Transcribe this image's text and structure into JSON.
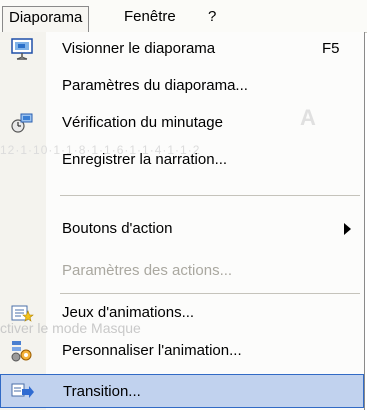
{
  "menubar": {
    "items": [
      {
        "label": "Diaporama",
        "active": true
      },
      {
        "label": "Fenêtre",
        "active": false
      },
      {
        "label": "?",
        "active": false
      }
    ]
  },
  "background_text": {
    "ruler": "12·1·10·1·1·8·1·1·6·1·1·4·1·1·2",
    "masque": "ctiver le mode Masque",
    "format_letter": "A"
  },
  "menu": {
    "items": [
      {
        "label": "Visionner le diaporama",
        "shortcut": "F5",
        "icon": "slideshow-icon"
      },
      {
        "label": "Paramètres du diaporama...",
        "shortcut": ""
      },
      {
        "label": "Vérification du minutage",
        "shortcut": "",
        "icon": "rehearse-timings-icon"
      },
      {
        "label": "Enregistrer la narration...",
        "shortcut": ""
      },
      {
        "label": "Boutons d'action",
        "submenu": true
      },
      {
        "label": "Paramètres des actions...",
        "disabled": true
      },
      {
        "label": "Jeux d'animations...",
        "icon": "animation-schemes-icon"
      },
      {
        "label": "Personnaliser l'animation...",
        "icon": "custom-animation-icon"
      },
      {
        "label": "Transition...",
        "icon": "transition-icon",
        "highlighted": true
      }
    ]
  },
  "colors": {
    "highlight_bg": "#c1d2ee",
    "highlight_border": "#316ac5",
    "disabled_text": "#aaa8a0",
    "gutter": "#f4f3ee"
  }
}
